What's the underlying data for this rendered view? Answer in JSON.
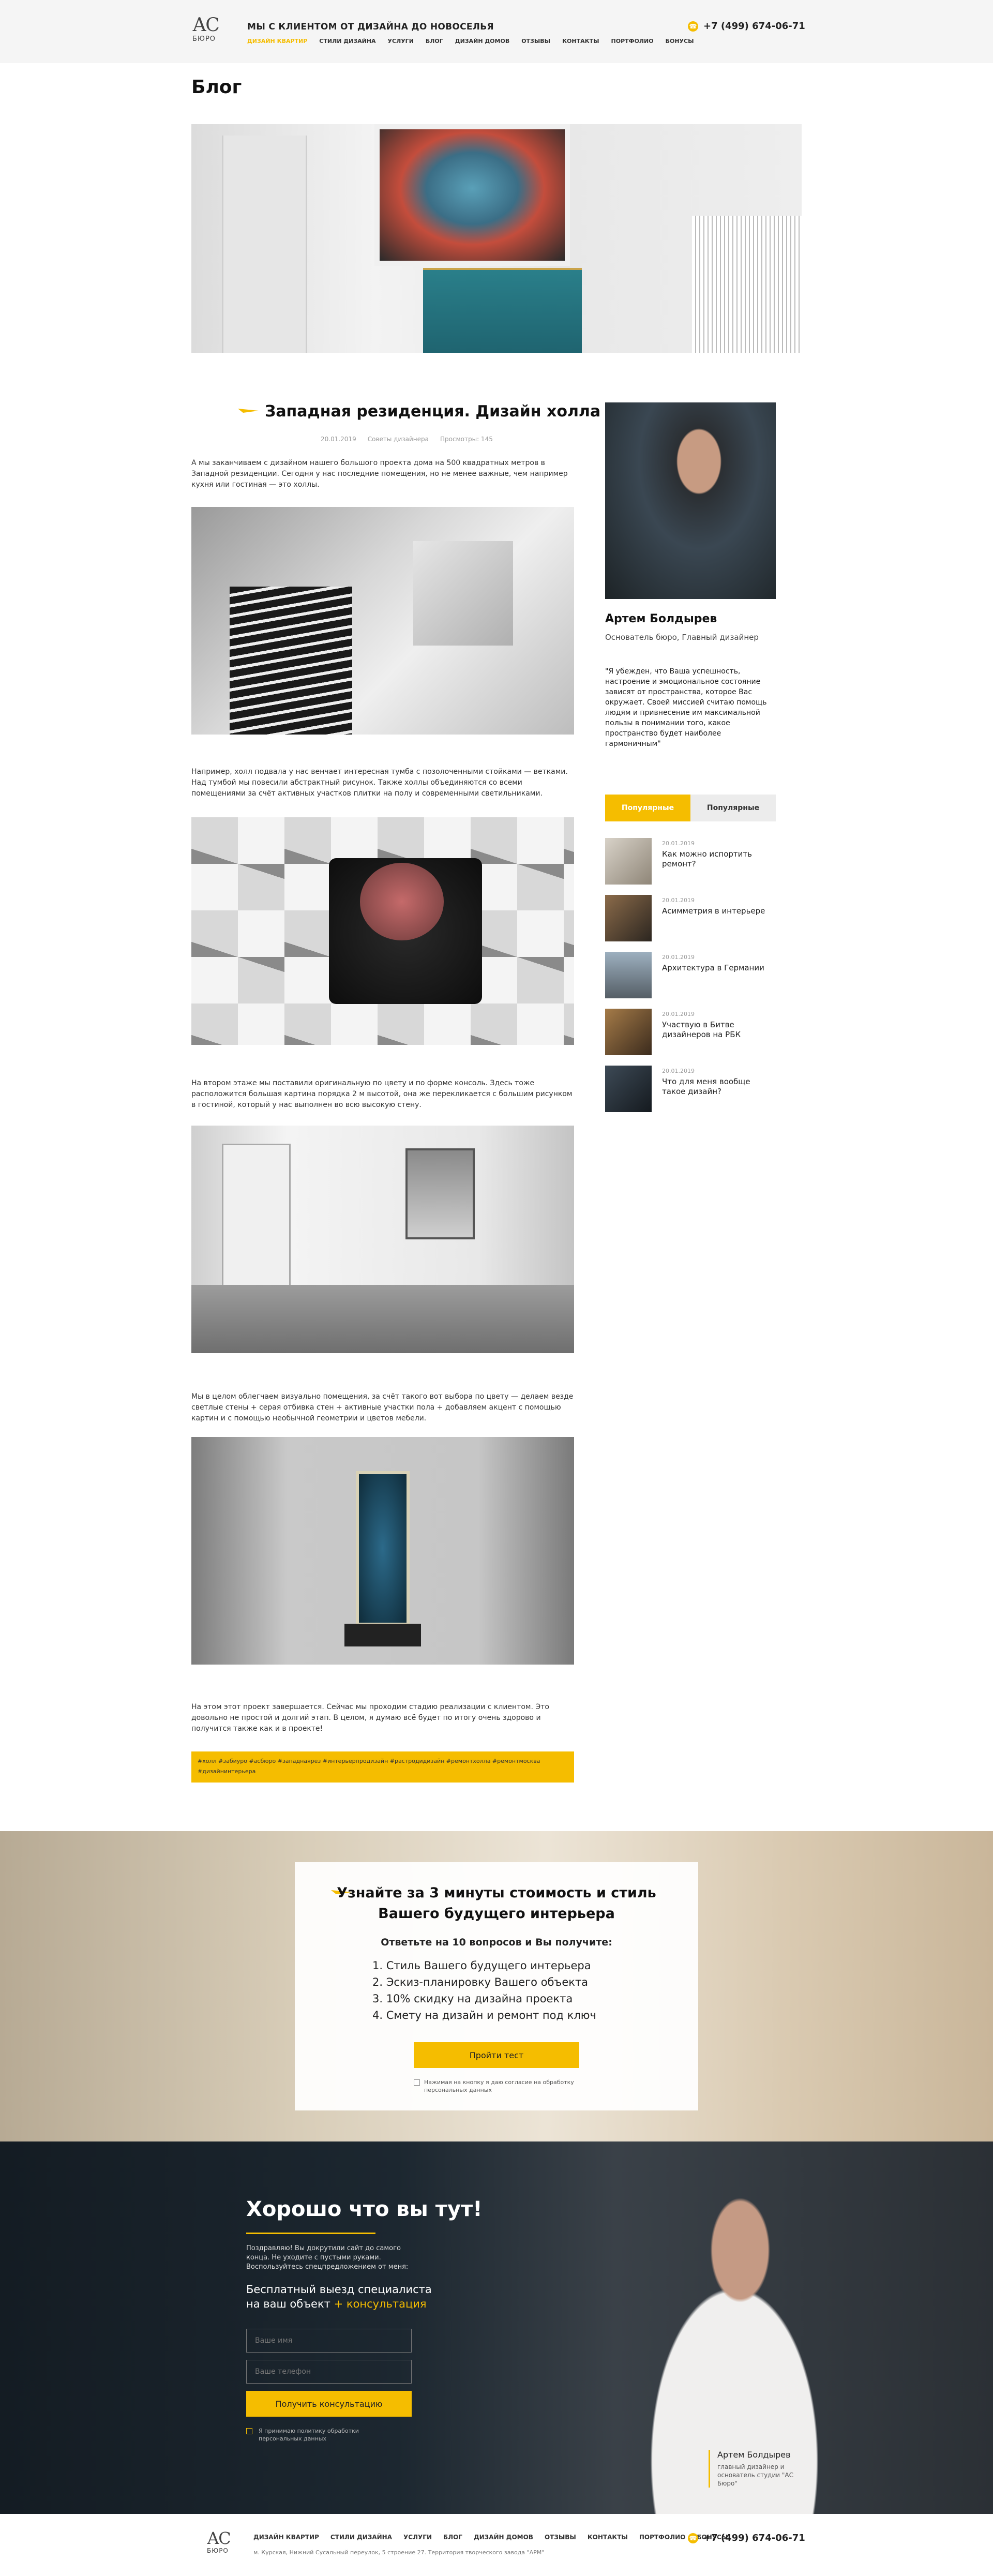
{
  "header": {
    "logo_text": "АС",
    "logo_sub": "БЮРО",
    "tagline": "МЫ С КЛИЕНТОМ ОТ ДИЗАЙНА ДО НОВОСЕЛЬЯ",
    "nav": [
      "ДИЗАЙН КВАРТИР",
      "СТИЛИ ДИЗАЙНА",
      "УСЛУГИ",
      "БЛОГ",
      "ДИЗАЙН ДОМОВ",
      "ОТЗЫВЫ",
      "КОНТАКТЫ",
      "ПОРТФОЛИО",
      "БОНУСЫ"
    ],
    "phone": "+7 (499) 674-06-71"
  },
  "page_title": "Блог",
  "article": {
    "title": "Западная резиденция. Дизайн холла",
    "date": "20.01.2019",
    "category": "Советы дизайнера",
    "views": "Просмотры: 145",
    "p1": "А мы заканчиваем с дизайном нашего большого проекта дома на 500 квадратных метров в Западной резиденции. Сегодня у нас последние помещения, но не менее важные, чем например кухня или гостиная — это холлы.",
    "p2": "Например, холл подвала у нас венчает интересная тумба с позолоченными стойками — ветками. Над тумбой мы повесили абстрактный рисунок. Также холлы объединяются со всеми помещениями за счёт активных участков плитки на полу и современными светильниками.",
    "p3": "На втором этаже мы поставили оригинальную по цвету и по форме консоль. Здесь тоже расположится большая картина порядка 2 м высотой, она же перекликается с большим рисунком в гостиной, который у нас выполнен во всю высокую стену.",
    "p4": "Мы в целом облегчаем визуально помещения, за счёт такого вот выбора по цвету — делаем везде светлые стены + серая отбивка стен + активные участки пола + добавляем акцент с помощью картин и с помощью необычной геометрии и цветов мебели.",
    "p5": "На этом этот проект завершается. Сейчас мы проходим стадию реализации с клиентом. Это довольно не простой и долгий этап. В целом, я думаю всё будет по итогу очень здорово и получится также как и в проекте!",
    "tags": "#холл #забиуро #асбюро #западнаярез #интерьерпродизайн #растродидизайн #ремонтхолла #ремонтмосква #дизайнинтерьера"
  },
  "author": {
    "name": "Артем Болдырев",
    "role": "Основатель бюро, Главный дизайнер",
    "quote": "\"Я убежден, что Ваша успешность, настроение и эмоциональное состояние зависят от пространства, которое Вас окружает. Своей миссией считаю помощь людям и привнесение им максимальной пользы в понимании того, какое пространство будет наиболее гармоничным\""
  },
  "sidebar": {
    "tabs": [
      "Популярные",
      "Популярные"
    ],
    "posts": [
      {
        "date": "20.01.2019",
        "title": "Как можно испортить ремонт?"
      },
      {
        "date": "20.01.2019",
        "title": "Асимметрия в интерьере"
      },
      {
        "date": "20.01.2019",
        "title": "Архитектура в Германии"
      },
      {
        "date": "20.01.2019",
        "title": "Участвую в Битве дизайнеров на РБК"
      },
      {
        "date": "20.01.2019",
        "title": "Что для меня вообще такое дизайн?"
      }
    ]
  },
  "quiz": {
    "title": "Узнайте за 3 минуты стоимость и стиль Вашего будущего интерьера",
    "subtitle": "Ответьте на 10 вопросов и Вы получите:",
    "items": [
      "1. Стиль Вашего будущего интерьера",
      "2. Эскиз-планировку Вашего объекта",
      "3. 10% скидку на дизайна проекта",
      "4. Смету на дизайн и ремонт под ключ"
    ],
    "button": "Пройти тест",
    "agree": "Нажимая на кнопку я даю согласие на обработку персональных данных"
  },
  "cta": {
    "title": "Хорошо что вы тут!",
    "text": "Поздравляю! Вы докрутили сайт до самого конца. Не уходите с пустыми руками. Воспользуйтесь спецпредложением от меня:",
    "offer": "Бесплатный выезд специалиста на ваш объект",
    "offer_plus": "+ консультация",
    "name_placeholder": "Ваше имя",
    "phone_placeholder": "Ваше телефон",
    "button": "Получить консультацию",
    "agree": "Я принимаю политику обработки персональных данных",
    "sign_name": "Артем Болдырев",
    "sign_role": "главный дизайнер и основатель студии \"АС Бюро\""
  },
  "footer": {
    "nav": [
      "ДИЗАЙН КВАРТИР",
      "СТИЛИ ДИЗАЙНА",
      "УСЛУГИ",
      "БЛОГ",
      "ДИЗАЙН ДОМОВ",
      "ОТЗЫВЫ",
      "КОНТАКТЫ",
      "ПОРТФОЛИО",
      "БОНУСЫ"
    ],
    "address": "м. Курская, Нижний Сусальный переулок, 5 строение 27. Территория творческого завода \"АРМ\"",
    "phone": "+7 (499) 674-06-71"
  },
  "colors": {
    "accent": "#f5bd00",
    "dark": "#1c2730"
  }
}
